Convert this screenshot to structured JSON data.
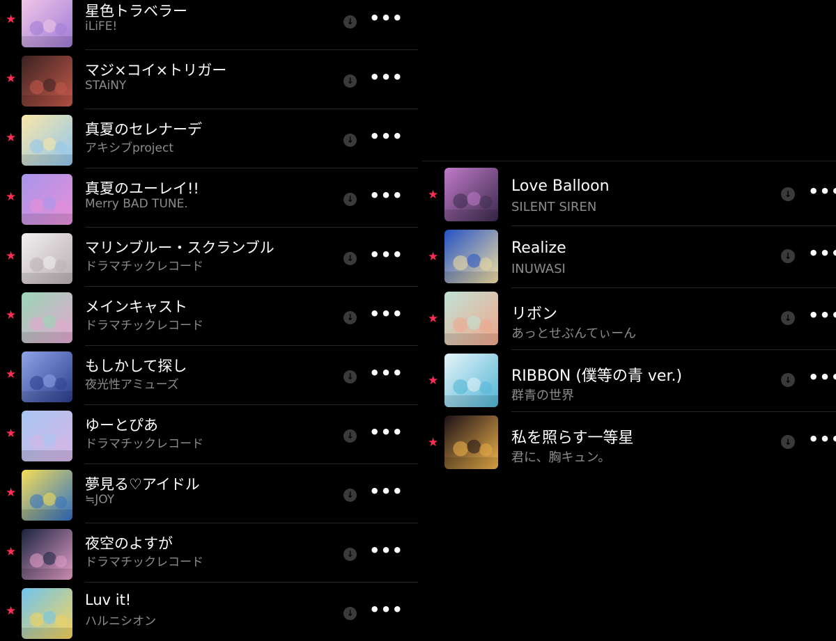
{
  "left_list": [
    {
      "title": "星色トラベラー",
      "artist": "iLiFE!",
      "art_colors": [
        "#f3c9e6",
        "#9e7ad6"
      ]
    },
    {
      "title": "マジ×コイ×トリガー",
      "artist": "STAiNY",
      "art_colors": [
        "#3a2222",
        "#c75a4a"
      ]
    },
    {
      "title": "真夏のセレナーデ",
      "artist": "アキシブproject",
      "art_colors": [
        "#fbe7a6",
        "#8fc6ef"
      ]
    },
    {
      "title": "真夏のユーレイ!!",
      "artist": "Merry BAD TUNE.",
      "art_colors": [
        "#a895ec",
        "#e78fd6"
      ]
    },
    {
      "title": "マリンブルー・スクランブル",
      "artist": "ドラマチックレコード",
      "art_colors": [
        "#f1eeee",
        "#b9afb4"
      ]
    },
    {
      "title": "メインキャスト",
      "artist": "ドラマチックレコード",
      "art_colors": [
        "#9ad7b7",
        "#e4a6cf"
      ]
    },
    {
      "title": "もしかして探し",
      "artist": "夜光性アミューズ",
      "art_colors": [
        "#8fa3e8",
        "#2a3d8c"
      ]
    },
    {
      "title": "ゆーとぴあ",
      "artist": "ドラマチックレコード",
      "art_colors": [
        "#a8c5f1",
        "#d6b6e6"
      ]
    },
    {
      "title": "夢見る♡アイドル",
      "artist": "≒JOY",
      "art_colors": [
        "#f6df55",
        "#2f6fc4"
      ]
    },
    {
      "title": "夜空のよすが",
      "artist": "ドラマチックレコード",
      "art_colors": [
        "#1a2340",
        "#e5a0c8"
      ]
    },
    {
      "title": "Luv it!",
      "artist": "ハルニシオン",
      "art_colors": [
        "#6fc4ef",
        "#f7d35a"
      ]
    }
  ],
  "right_list": [
    {
      "title": "Love Balloon",
      "artist": "SILENT SIREN",
      "art_colors": [
        "#c07ac8",
        "#3a2a4c"
      ]
    },
    {
      "title": "Realize",
      "artist": "INUWASI",
      "art_colors": [
        "#2452c6",
        "#f2dfa1"
      ]
    },
    {
      "title": "リボン",
      "artist": "あっとせぶんてぃーん",
      "art_colors": [
        "#bfe3d6",
        "#f0a58a"
      ]
    },
    {
      "title": "RIBBON (僕等の青 ver.)",
      "artist": "群青の世界",
      "art_colors": [
        "#e7f4f8",
        "#4fb4d6"
      ]
    },
    {
      "title": "私を照らす一等星",
      "artist": "君に、胸キュン。",
      "art_colors": [
        "#1b1018",
        "#f0b44a"
      ]
    }
  ],
  "icons": {
    "favorite": "star-icon",
    "download": "arrow-down-circle-icon",
    "more": "ellipsis-icon"
  },
  "glyphs": {
    "star": "★",
    "download": "↓",
    "more": "•••"
  },
  "colors": {
    "background": "#000000",
    "star": "#ff2d55",
    "artist_text": "#8c8c8c",
    "download_circle": "#3a3a3c"
  }
}
